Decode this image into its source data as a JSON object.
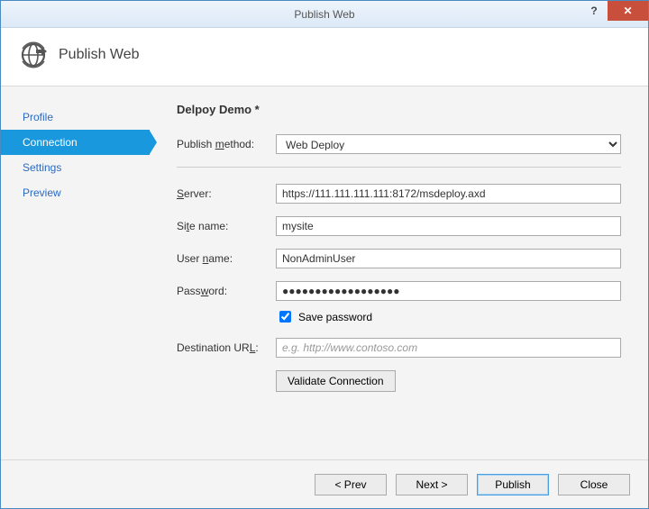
{
  "window": {
    "title": "Publish Web",
    "help_glyph": "?",
    "close_glyph": "✕"
  },
  "header": {
    "title": "Publish Web"
  },
  "sidebar": {
    "items": [
      {
        "label": "Profile",
        "active": false
      },
      {
        "label": "Connection",
        "active": true
      },
      {
        "label": "Settings",
        "active": false
      },
      {
        "label": "Preview",
        "active": false
      }
    ]
  },
  "main": {
    "heading": "Delpoy Demo *",
    "publish_method": {
      "label_pre": "Publish ",
      "label_ul": "m",
      "label_post": "ethod:",
      "value": "Web Deploy"
    },
    "server": {
      "label_ul": "S",
      "label_post": "erver:",
      "value": "https://111.111.111.111:8172/msdeploy.axd"
    },
    "site_name": {
      "label_pre": "Si",
      "label_ul": "t",
      "label_post": "e name:",
      "value": "mysite"
    },
    "user_name": {
      "label_pre": "User ",
      "label_ul": "n",
      "label_post": "ame:",
      "value": "NonAdminUser"
    },
    "password": {
      "label_pre": "Pass",
      "label_ul": "w",
      "label_post": "ord:",
      "value": "●●●●●●●●●●●●●●●●●●"
    },
    "save_password": {
      "label_pre": "Save pass",
      "label_ul": "w",
      "label_post": "ord",
      "checked": true
    },
    "destination_url": {
      "label_pre": "Destination UR",
      "label_ul": "L",
      "label_post": ":",
      "placeholder": "e.g. http://www.contoso.com",
      "value": ""
    },
    "validate_button": {
      "label_ul": "V",
      "label_post": "alidate Connection"
    }
  },
  "footer": {
    "prev": {
      "pre": "< P",
      "ul": "r",
      "post": "ev"
    },
    "next": {
      "pre": "Ne",
      "ul": "x",
      "post": "t >"
    },
    "publish": {
      "pre": "P",
      "ul": "u",
      "post": "blish"
    },
    "close": {
      "pre": "",
      "ul": "C",
      "post": "lose"
    }
  }
}
